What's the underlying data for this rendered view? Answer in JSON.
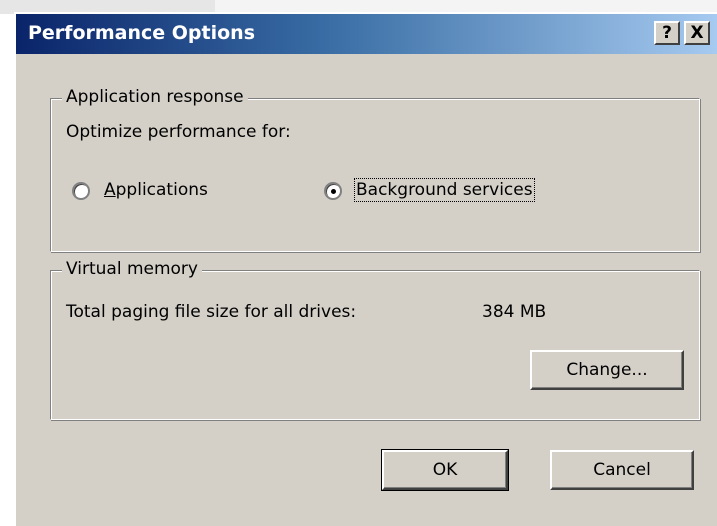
{
  "window": {
    "title": "Performance Options",
    "help_glyph": "?",
    "close_glyph": "X"
  },
  "app_response": {
    "legend": "Application response",
    "prompt": "Optimize performance for:",
    "options": [
      {
        "label": "Applications",
        "selected": false
      },
      {
        "label": "Background services",
        "selected": true
      }
    ]
  },
  "virtual_memory": {
    "legend": "Virtual memory",
    "label": "Total paging file size for all drives:",
    "value": "384 MB",
    "change_label": "Change..."
  },
  "buttons": {
    "ok": "OK",
    "cancel": "Cancel"
  },
  "colors": {
    "face": "#d4d0c8",
    "title_start": "#0a246a",
    "title_end": "#a6caf0"
  }
}
